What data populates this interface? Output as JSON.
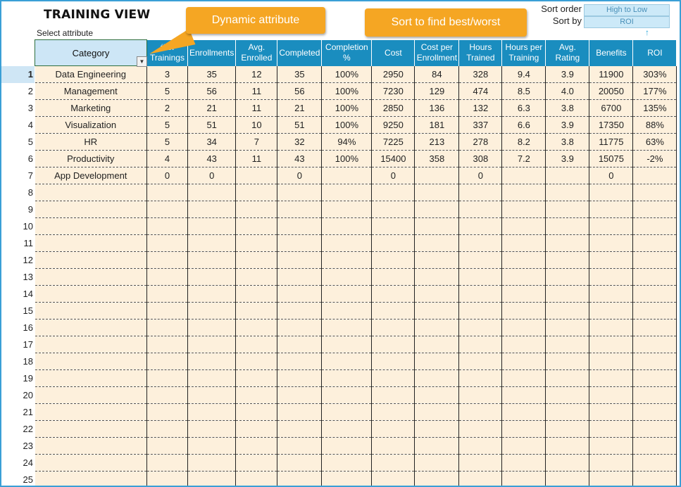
{
  "title": "TRAINING VIEW",
  "select_attribute_label": "Select attribute",
  "callouts": {
    "dynamic_attribute": "Dynamic attribute",
    "sort_tip": "Sort to find best/worst"
  },
  "sort": {
    "order_label": "Sort order",
    "order_value": "High to Low",
    "by_label": "Sort by",
    "by_value": "ROI",
    "indicator": "↑"
  },
  "columns": [
    "Category",
    "# of Trainings",
    "Enrollments",
    "Avg. Enrolled",
    "Completed",
    "Completion %",
    "Cost",
    "Cost per Enrollment",
    "Hours Trained",
    "Hours per Training",
    "Avg. Rating",
    "Benefits",
    "ROI"
  ],
  "row_numbers": [
    "1",
    "2",
    "3",
    "4",
    "5",
    "6",
    "7",
    "8",
    "9",
    "10",
    "11",
    "12",
    "13",
    "14",
    "15",
    "16",
    "17",
    "18",
    "19",
    "20",
    "21",
    "22",
    "23",
    "24",
    "25"
  ],
  "rows": [
    [
      "Data Engineering",
      "3",
      "35",
      "12",
      "35",
      "100%",
      "2950",
      "84",
      "328",
      "9.4",
      "3.9",
      "11900",
      "303%"
    ],
    [
      "Management",
      "5",
      "56",
      "11",
      "56",
      "100%",
      "7230",
      "129",
      "474",
      "8.5",
      "4.0",
      "20050",
      "177%"
    ],
    [
      "Marketing",
      "2",
      "21",
      "11",
      "21",
      "100%",
      "2850",
      "136",
      "132",
      "6.3",
      "3.8",
      "6700",
      "135%"
    ],
    [
      "Visualization",
      "5",
      "51",
      "10",
      "51",
      "100%",
      "9250",
      "181",
      "337",
      "6.6",
      "3.9",
      "17350",
      "88%"
    ],
    [
      "HR",
      "5",
      "34",
      "7",
      "32",
      "94%",
      "7225",
      "213",
      "278",
      "8.2",
      "3.8",
      "11775",
      "63%"
    ],
    [
      "Productivity",
      "4",
      "43",
      "11",
      "43",
      "100%",
      "15400",
      "358",
      "308",
      "7.2",
      "3.9",
      "15075",
      "-2%"
    ],
    [
      "App Development",
      "0",
      "0",
      "",
      "0",
      "",
      "0",
      "",
      "0",
      "",
      "",
      "0",
      ""
    ]
  ],
  "colors": {
    "header_blue": "#1a8dbf",
    "category_header": "#cde6f6",
    "cell_fill": "#fdf0dc",
    "callout": "#f5a623",
    "frame": "#3a9fd6"
  }
}
